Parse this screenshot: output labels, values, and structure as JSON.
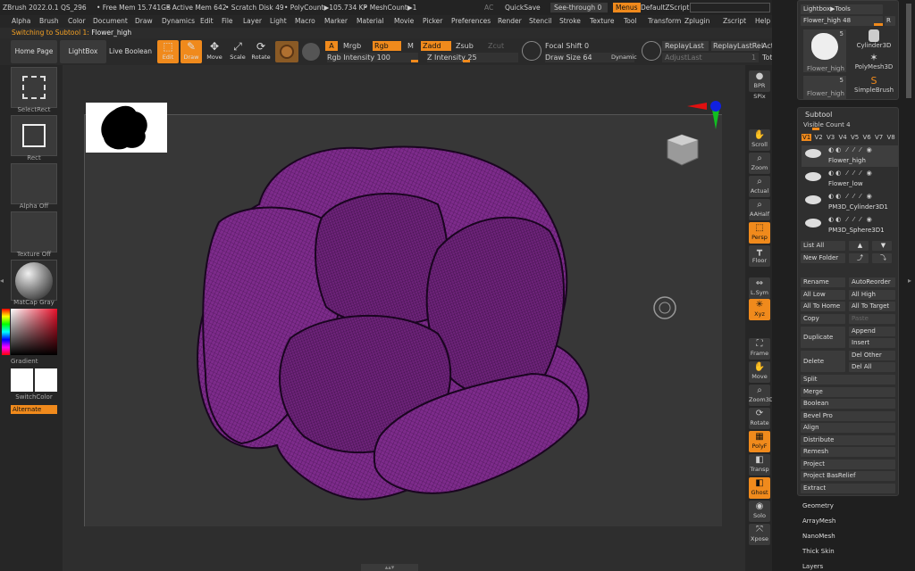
{
  "titlebar": {
    "app": "ZBrush 2022.0.1 QS_296",
    "free_mem": "• Free Mem 15.741GB",
    "active_mem": "• Active Mem 642",
    "scratch": "• Scratch Disk 49",
    "polycount": "• PolyCount▶105.734 KP",
    "meshcount": "• MeshCount▶1",
    "ac": "AC",
    "quicksave": "QuickSave",
    "see_through": "See-through  0",
    "menus": "Menus",
    "default_script": "DefaultZScript"
  },
  "menubar": [
    "Alpha",
    "Brush",
    "Color",
    "Document",
    "Draw",
    "Dynamics",
    "Edit",
    "File",
    "Layer",
    "Light",
    "Macro",
    "Marker",
    "Material",
    "Movie",
    "Picker",
    "Preferences",
    "Render",
    "Stencil",
    "Stroke",
    "Texture",
    "Tool",
    "Transform",
    "Zplugin",
    "Zscript",
    "Help"
  ],
  "status": {
    "prefix": "Switching to Subtool 1:",
    "name": "Flower_high"
  },
  "toolbar": {
    "home": "Home Page",
    "lightbox": "LightBox",
    "live_boolean": "Live Boolean",
    "edit": "Edit",
    "draw": "Draw",
    "move": "Move",
    "scale": "Scale",
    "rotate": "Rotate",
    "a": "A",
    "mrgb": "Mrgb",
    "rgb": "Rgb",
    "m": "M",
    "zadd": "Zadd",
    "zsub": "Zsub",
    "zcut": "Zcut",
    "rgb_intensity": "Rgb Intensity 100",
    "z_intensity": "Z Intensity 25",
    "focal_shift": "Focal Shift 0",
    "draw_size": "Draw Size 64",
    "dynamic": "Dynamic",
    "replay_last": "ReplayLast",
    "replay_last_rel": "ReplayLastRel",
    "act": "Act",
    "adjust_last": "AdjustLast",
    "adjust_val": "1",
    "tot": "Tot"
  },
  "left": {
    "select_rect": "SelectRect",
    "rect": "Rect",
    "alpha_off": "Alpha Off",
    "texture_off": "Texture Off",
    "matcap": "MatCap Gray",
    "gradient": "Gradient",
    "switchcolor": "SwitchColor",
    "alternate": "Alternate"
  },
  "right_shelf": [
    "BPR",
    "SPix",
    "Scroll",
    "Zoom",
    "Actual",
    "AAHalf",
    "Persp",
    "Floor",
    "L.Sym",
    "",
    "Xyz",
    "",
    "",
    "Frame",
    "Move",
    "Zoom3D",
    "Rotate",
    "PolyF",
    "Transp",
    "Ghost",
    "Solo",
    "Xpose"
  ],
  "tray": {
    "lightbox_tools": "Lightbox▶Tools",
    "tool_name": "Flower_high  48",
    "r": "R",
    "thumbs": [
      {
        "label": "Flower_high",
        "count": "5"
      },
      {
        "label": "Cylinder3D"
      },
      {
        "label": "PolyMesh3D"
      },
      {
        "label": "Flower_high",
        "count": "5"
      },
      {
        "label": "SimpleBrush"
      }
    ],
    "subtool_title": "Subtool",
    "visible_count": "Visible Count 4",
    "versions": [
      "V1",
      "V2",
      "V3",
      "V4",
      "V5",
      "V6",
      "V7",
      "V8"
    ],
    "subtools": [
      "Flower_high",
      "Flower_low",
      "PM3D_Cylinder3D1",
      "PM3D_Sphere3D1"
    ],
    "buttons": {
      "list_all": "List All",
      "new_folder": "New Folder",
      "rename": "Rename",
      "auto_reorder": "AutoReorder",
      "all_low": "All Low",
      "all_high": "All High",
      "all_to_home": "All To Home",
      "all_to_target": "All To Target",
      "copy": "Copy",
      "paste": "Paste",
      "duplicate": "Duplicate",
      "append": "Append",
      "insert": "Insert",
      "delete": "Delete",
      "del_other": "Del Other",
      "del_all": "Del All"
    },
    "actions": [
      "Split",
      "Merge",
      "Boolean",
      "Bevel Pro",
      "Align",
      "Distribute",
      "Remesh",
      "Project",
      "Project BasRelief",
      "Extract"
    ],
    "sections": [
      "Geometry",
      "ArrayMesh",
      "NanoMesh",
      "Thick Skin",
      "Layers"
    ]
  },
  "colors": {
    "accent": "#f08a1c",
    "mesh": "#7a2a86",
    "mesh_dark": "#3b0f45"
  }
}
